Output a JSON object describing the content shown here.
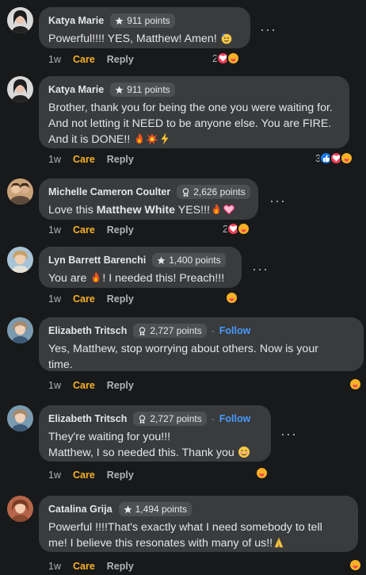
{
  "comments": [
    {
      "author": "Katya Marie",
      "points": "911 points",
      "badge_icon": "star-icon",
      "text_parts": [
        "Powerful!!!! YES, Matthew! Amen! "
      ],
      "emojis": [
        "partying-face"
      ],
      "time": "1w",
      "care": "Care",
      "reply": "Reply",
      "reaction_count": "2",
      "reactions": [
        "love",
        "care"
      ]
    },
    {
      "author": "Katya Marie",
      "points": "911 points",
      "badge_icon": "star-icon",
      "lines": [
        "Brother, thank you for being the one you were waiting for.",
        "And not letting it NEED to be anyone else. You are FIRE.",
        "And  it is DONE!! "
      ],
      "emojis": [
        "fire",
        "collision",
        "lightning"
      ],
      "time": "1w",
      "care": "Care",
      "reply": "Reply",
      "reaction_count": "3",
      "reactions": [
        "like",
        "love",
        "care"
      ]
    },
    {
      "author": "Michelle Cameron Coulter",
      "points": "2,626 points",
      "badge_icon": "award-icon",
      "text_before": "Love this ",
      "text_bold": "Matthew White",
      "text_after": " YES!!!",
      "emojis": [
        "fire",
        "red-heart"
      ],
      "time": "1w",
      "care": "Care",
      "reply": "Reply",
      "reaction_count": "2",
      "reactions": [
        "love",
        "care"
      ]
    },
    {
      "author": "Lyn Barrett Barenchi",
      "points": "1,400 points",
      "badge_icon": "star-icon",
      "text_before": "You are ",
      "text_after": "! I needed this! Preach!!!",
      "emojis": [
        "fire"
      ],
      "time": "1w",
      "care": "Care",
      "reply": "Reply",
      "reactions": [
        "care"
      ]
    },
    {
      "author": "Elizabeth Tritsch",
      "points": "2,727 points",
      "badge_icon": "award-icon",
      "follow": "Follow",
      "lines": [
        "Yes, Matthew, stop worrying about others. Now is your",
        "time."
      ],
      "time": "1w",
      "care": "Care",
      "reply": "Reply",
      "reactions": [
        "care"
      ]
    },
    {
      "author": "Elizabeth Tritsch",
      "points": "2,727 points",
      "badge_icon": "award-icon",
      "follow": "Follow",
      "lines": [
        "They're waiting for you!!!",
        "Matthew, I so needed this. Thank you "
      ],
      "emojis": [
        "smiling-face"
      ],
      "time": "1w",
      "care": "Care",
      "reply": "Reply",
      "reactions": [
        "care"
      ]
    },
    {
      "author": "Catalina Grija",
      "points": "1,494 points",
      "badge_icon": "star-icon",
      "lines": [
        "Powerful !!!!That's exactly what I need somebody to tell",
        "me! I believe this resonates with many of us!!"
      ],
      "emojis": [
        "folded-hands"
      ],
      "time": "1w",
      "care": "Care",
      "reply": "Reply",
      "reactions": [
        "care"
      ]
    }
  ],
  "more_icon": "more-options-icon",
  "colors": {
    "background": "#18191a",
    "bubble": "#3a3b3c",
    "badge": "#4e4f50",
    "care": "#f7b125",
    "follow": "#4599ff",
    "secondary_text": "#b0b3b8"
  }
}
